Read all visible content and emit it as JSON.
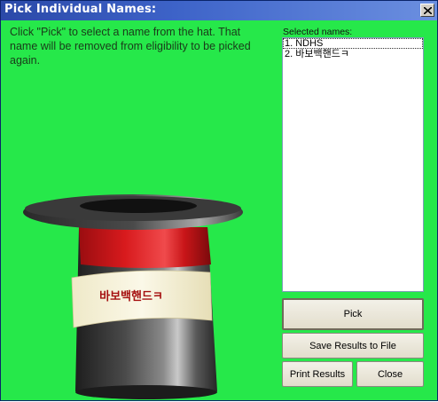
{
  "window": {
    "title": "Pick Individual Names:"
  },
  "instructions": "Click \"Pick\" to select a name from the hat. That name will be removed from eligibility to be picked again.",
  "selected": {
    "label": "Selected names:",
    "items": [
      "1. NDHS",
      "2. 바보백핸드ㅋ"
    ]
  },
  "hat": {
    "tag_name": "바보백핸드ㅋ"
  },
  "buttons": {
    "pick": "Pick",
    "save": "Save Results to File",
    "print": "Print Results",
    "close": "Close"
  },
  "colors": {
    "background": "#26e84a",
    "titlebar": "#2b49a8",
    "hat_band": "#e0191c",
    "tag_text": "#a50f0f"
  }
}
